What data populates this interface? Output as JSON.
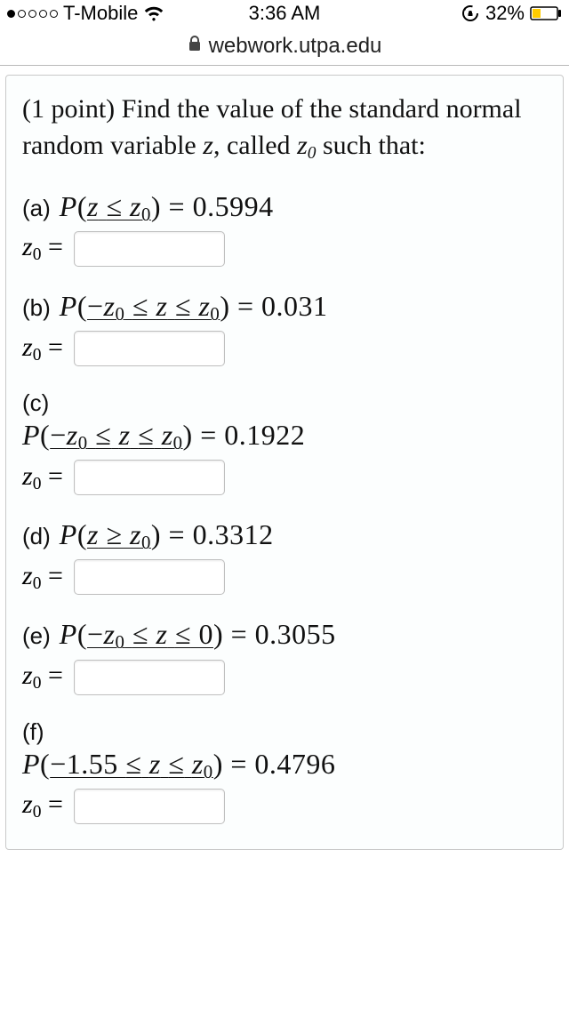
{
  "status": {
    "carrier": "T-Mobile",
    "time": "3:36 AM",
    "battery_pct": "32%"
  },
  "address": {
    "host": "webwork.utpa.edu"
  },
  "problem": {
    "points_label": "(1 point)",
    "prompt_text_1": "Find the value of the standard normal random variable",
    "prompt_text_2": ", called",
    "prompt_text_3": "such that:",
    "z_var": "z",
    "z0_var": "z",
    "z0_sub": "0",
    "answer_prefix": "=",
    "parts": [
      {
        "letter": "(a)",
        "expr_html": "P(z ≤ z0) = 0.5994",
        "value": "0.5994"
      },
      {
        "letter": "(b)",
        "expr_html": "P(−z0 ≤ z ≤ z0) = 0.031",
        "value": "0.031"
      },
      {
        "letter": "(c)",
        "expr_html": "P(−z0 ≤ z ≤ z0) = 0.1922",
        "value": "0.1922"
      },
      {
        "letter": "(d)",
        "expr_html": "P(z ≥ z0) = 0.3312",
        "value": "0.3312"
      },
      {
        "letter": "(e)",
        "expr_html": "P(−z0 ≤ z ≤ 0) = 0.3055",
        "value": "0.3055"
      },
      {
        "letter": "(f)",
        "expr_html": "P(−1.55 ≤ z ≤ z0) = 0.4796",
        "value": "0.4796"
      }
    ]
  }
}
